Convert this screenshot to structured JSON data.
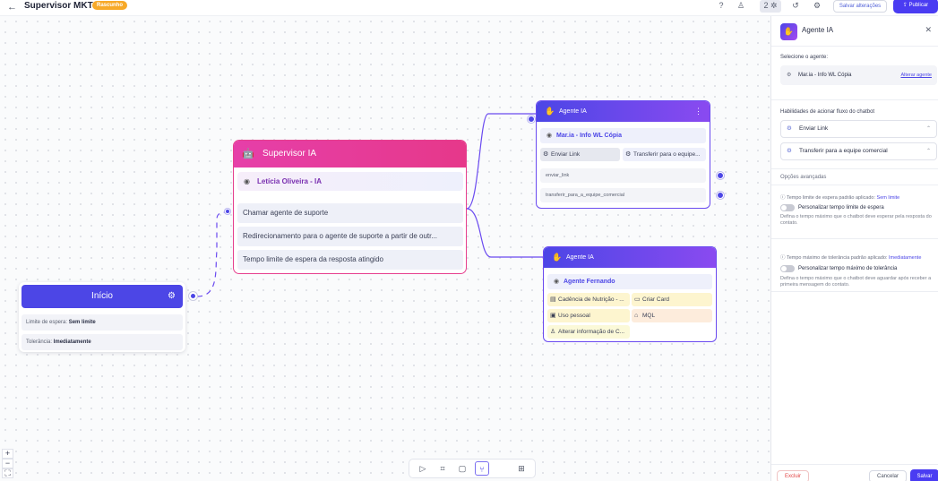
{
  "header": {
    "back_icon": "arrow-left-icon",
    "title": "Supervisor MKT",
    "badge": "Rascunho",
    "save_changes": "Salvar alterações",
    "publish": "Publicar",
    "counter": "2"
  },
  "start_node": {
    "title": "Início",
    "rows": [
      {
        "label": "Limite de espera:",
        "value": "Sem limite"
      },
      {
        "label": "Tolerância:",
        "value": "Imediatamente"
      }
    ]
  },
  "supervisor_node": {
    "title": "Supervisor IA",
    "agent": "Letícia Oliveira - IA",
    "rows": [
      "Chamar agente de suporte",
      "Redirecionamento para o agente de suporte a partir de outr...",
      "Tempo limite de espera da resposta atingido"
    ]
  },
  "agent_node_1": {
    "title": "Agente IA",
    "agent": "Mar.ia - Info WL Cópia",
    "chips": [
      "Enviar Link",
      "Transferir para o equipe..."
    ],
    "outputs": [
      "enviar_link",
      "transferir_para_a_equipe_comercial"
    ]
  },
  "agent_node_2": {
    "title": "Agente IA",
    "agent": "Agente Fernando",
    "chips": [
      "Cadência de Nutrição - ...",
      "Criar Card",
      "Uso pessoal",
      "MQL",
      "Alterar informação de C..."
    ]
  },
  "panel": {
    "title": "Agente IA",
    "select_agent_label": "Selecione o agente:",
    "selected_agent": "Mar.ia - Info WL Cópia",
    "change_agent": "Alterar agente",
    "skills_label": "Habilidades de acionar fluxo do chatbot",
    "skills": [
      "Enviar Link",
      "Transferir para a equipe comercial"
    ],
    "advanced_label": "Opções avançadas",
    "wait_info": "Tempo limite de espera padrão aplicado:",
    "wait_value": "Sem limite",
    "wait_toggle": "Personalizar tempo limite de espera",
    "wait_desc": "Defina o tempo máximo que o chatbot deve esperar pela resposta do contato.",
    "tol_info": "Tempo máximo de tolerância padrão aplicado:",
    "tol_value": "Imediatamente",
    "tol_toggle": "Personalizar tempo máximo de tolerância",
    "tol_desc": "Defina o tempo máximo que o chatbot deve aguardar após receber a primeira mensagem do contato.",
    "delete": "Excluir",
    "cancel": "Cancelar",
    "save": "Salvar"
  },
  "colors": {
    "accent": "#4a3cf2",
    "supervisor": "#e63f8e",
    "badge": "#f7a928"
  }
}
